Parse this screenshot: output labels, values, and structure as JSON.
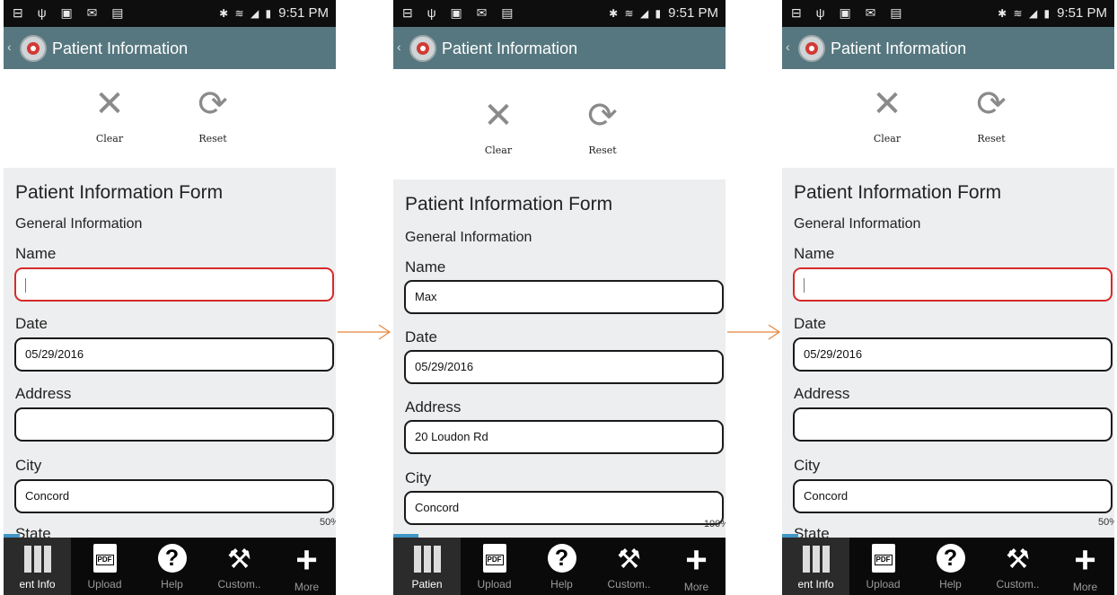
{
  "status": {
    "left_icons": "⊟ ψ ▣ ✉ ▤",
    "right_icons": "✱ ≋ ◢ ▮",
    "time": "9:51 PM"
  },
  "header": {
    "back": "‹",
    "title": "Patient Information"
  },
  "toolbar": {
    "clear_label": "Clear",
    "reset_label": "Reset"
  },
  "form_title": "Patient Information Form",
  "section_title": "General Information",
  "labels": {
    "name": "Name",
    "date": "Date",
    "address": "Address",
    "city": "City",
    "state_partial": "State"
  },
  "nav": [
    {
      "label": "Patient Info",
      "icon": "binders-icon"
    },
    {
      "label": "Upload",
      "icon": "pdf-icon"
    },
    {
      "label": "Help",
      "icon": "help-icon"
    },
    {
      "label": "Custom..",
      "icon": "tools-icon"
    },
    {
      "label": "More",
      "icon": "plus-icon"
    }
  ],
  "screens": [
    {
      "values": {
        "name": "",
        "date": "05/29/2016",
        "address": "",
        "city": "Concord"
      },
      "progress_text": "50%",
      "progress": 0.5,
      "name_error": true,
      "nav_label_first": "ent Info"
    },
    {
      "values": {
        "name": "Max",
        "date": "05/29/2016",
        "address": "20 Loudon Rd",
        "city": "Concord"
      },
      "progress_text": "100%",
      "progress": 1.0,
      "name_error": false,
      "nav_label_first": "Patien"
    },
    {
      "values": {
        "name": "",
        "date": "05/29/2016",
        "address": "",
        "city": "Concord"
      },
      "progress_text": "50%",
      "progress": 0.5,
      "name_error": true,
      "nav_label_first": "ent Info"
    }
  ],
  "colors": {
    "appbar": "#56777f",
    "form_bg": "#eceeef",
    "error_border": "#d62a2a",
    "progress": "#3f96c7",
    "arrow": "#e8843c"
  }
}
